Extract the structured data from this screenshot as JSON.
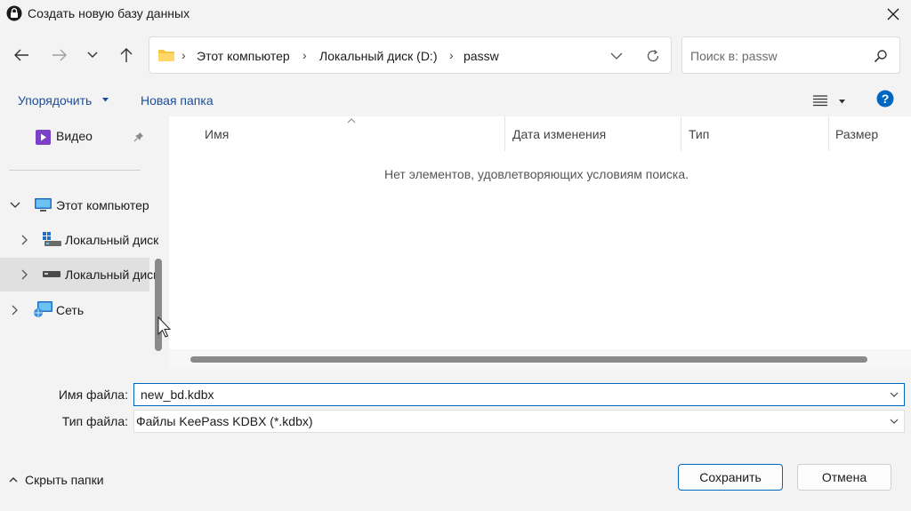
{
  "window": {
    "title": "Создать новую базу данных"
  },
  "address_bar": {
    "breadcrumbs": [
      "Этот компьютер",
      "Локальный диск (D:)",
      "passw"
    ]
  },
  "search": {
    "placeholder": "Поиск в: passw"
  },
  "toolbar": {
    "organize_label": "Упорядочить",
    "new_folder_label": "Новая папка"
  },
  "nav_pane": {
    "items": [
      {
        "label": "Видео",
        "icon": "video-icon"
      },
      {
        "label": "Этот компьютер",
        "icon": "computer-icon"
      },
      {
        "label": "Локальный диск",
        "icon": "drive-icon"
      },
      {
        "label": "Локальный диск",
        "icon": "drive-icon"
      },
      {
        "label": "Сеть",
        "icon": "network-icon"
      }
    ]
  },
  "file_list": {
    "columns": [
      "Имя",
      "Дата изменения",
      "Тип",
      "Размер"
    ],
    "empty_message": "Нет элементов, удовлетворяющих условиям поиска."
  },
  "form": {
    "filename_label": "Имя файла:",
    "filename_value": "new_bd.kdbx",
    "filetype_label": "Тип файла:",
    "filetype_value": "Файлы KeePass KDBX (*.kdbx)"
  },
  "footer": {
    "hide_folders_label": "Скрыть папки",
    "save_label": "Сохранить",
    "cancel_label": "Отмена"
  },
  "colors": {
    "accent": "#0067c0",
    "selected_nav": "#e0e0e0"
  }
}
